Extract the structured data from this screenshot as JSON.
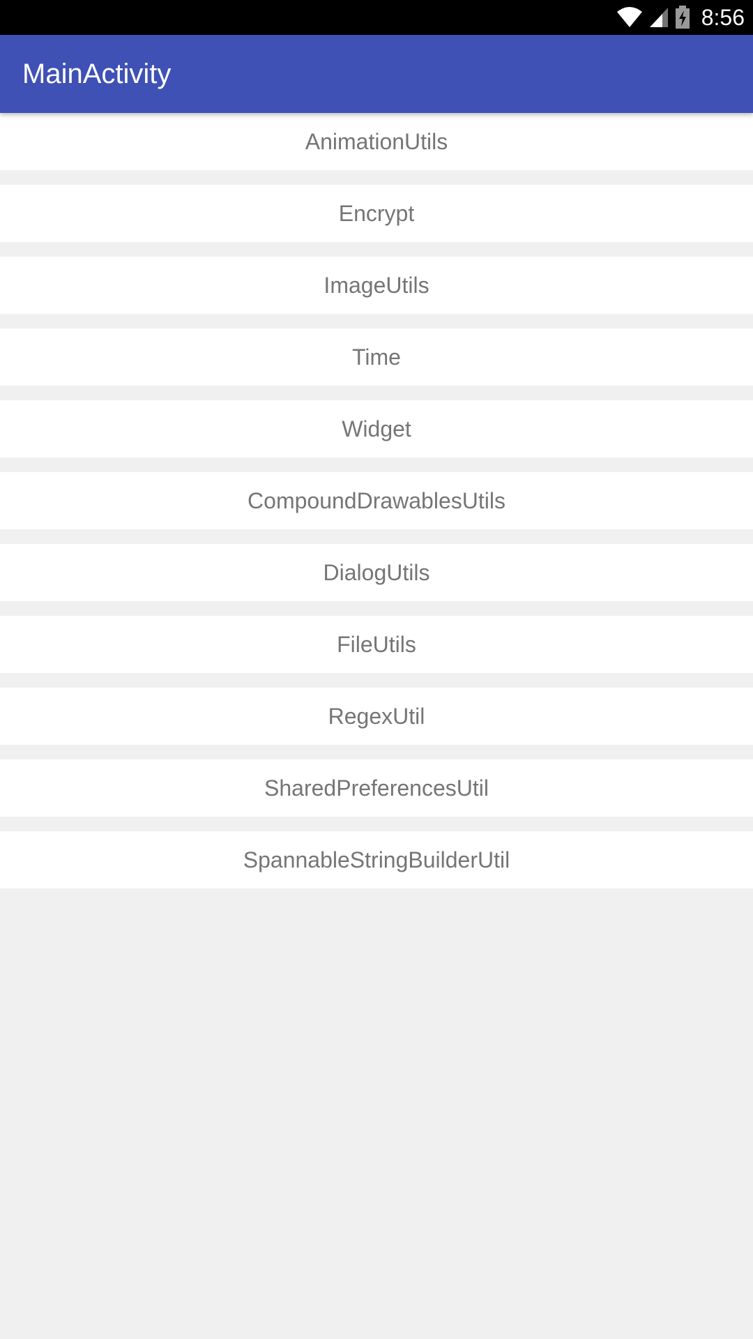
{
  "status_bar": {
    "time": "8:56",
    "icons": [
      "wifi-icon",
      "cell-signal-icon",
      "battery-charging-icon"
    ]
  },
  "app_bar": {
    "title": "MainActivity",
    "color": "#3f51b5"
  },
  "list": {
    "items": [
      {
        "label": "AnimationUtils"
      },
      {
        "label": "Encrypt"
      },
      {
        "label": "ImageUtils"
      },
      {
        "label": "Time"
      },
      {
        "label": "Widget"
      },
      {
        "label": "CompoundDrawablesUtils"
      },
      {
        "label": "DialogUtils"
      },
      {
        "label": "FileUtils"
      },
      {
        "label": "RegexUtil"
      },
      {
        "label": "SharedPreferencesUtil"
      },
      {
        "label": "SpannableStringBuilderUtil"
      }
    ]
  }
}
